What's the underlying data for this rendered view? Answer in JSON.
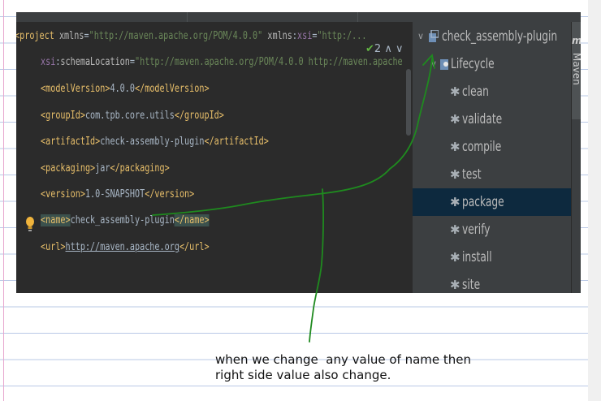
{
  "editor": {
    "line1": {
      "bracket_open": "<",
      "tag": "project",
      "attr1_name": "xmlns",
      "attr1_eq": "=",
      "attr1_value": "\"http://maven.apache.org/POM/4.0.0\"",
      "attr2_ns": "xmlns",
      "attr2_colon": ":",
      "attr2_local": "xsi",
      "attr2_eq": "=",
      "attr2_value": "\"http:/..."
    },
    "line2": {
      "ns": "xsi",
      "colon": ":",
      "local": "schemaLocation",
      "eq": "=",
      "value": "\"http://maven.apache.org/POM/4.0.0 http://maven.apache"
    },
    "elements": [
      {
        "open": "<modelVersion>",
        "value": "4.0.0",
        "close": "</modelVersion>"
      },
      {
        "open": "<groupId>",
        "value": "com.tpb.core.utils",
        "close": "</groupId>"
      },
      {
        "open": "<artifactId>",
        "value": "check-assembly-plugin",
        "close": "</artifactId>"
      },
      {
        "open": "<packaging>",
        "value": "jar",
        "close": "</packaging>"
      },
      {
        "open": "<version>",
        "value": "1.0-SNAPSHOT",
        "close": "</version>"
      },
      {
        "open": "<name>",
        "value": "check_assembly-plugin",
        "close": "</name>"
      },
      {
        "open": "<url>",
        "value": "http://maven.apache.org",
        "close": "</url>"
      }
    ],
    "inspection": {
      "icon": "check-icon",
      "count": "2",
      "up": "∧",
      "down": "∨"
    }
  },
  "maven": {
    "tool_window_title": "Maven",
    "project": "check_assembly-plugin",
    "lifecycle": "Lifecycle",
    "phases": [
      "clean",
      "validate",
      "compile",
      "test",
      "package",
      "verify",
      "install",
      "site"
    ],
    "selected_phase": "package"
  },
  "note": {
    "line1": "when we change  any value of name then",
    "line2": "right side value also change."
  },
  "colors": {
    "editor_bg": "#2b2b2b",
    "panel_bg": "#3c3f41",
    "selection": "#0d293e",
    "tag": "#e8bf6a",
    "string": "#6a8759",
    "annotation_ink": "#1f8a1f"
  }
}
